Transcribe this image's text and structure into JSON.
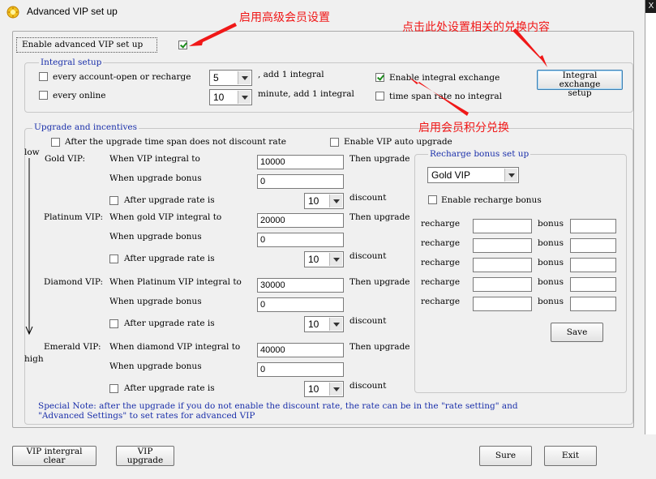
{
  "window": {
    "title": "Advanced VIP set up",
    "close_label": "X"
  },
  "annotations": {
    "enable_advanced": "启用高级会员设置",
    "click_exchange": "点击此处设置相关的兑换内容",
    "enable_points": "启用会员积分兑换"
  },
  "enable_advanced": {
    "label": "Enable advanced VIP set up",
    "checked": true
  },
  "integral_setup": {
    "legend": "Integral setup",
    "every_account": {
      "label": "every account-open or recharge",
      "checked": false
    },
    "account_value": "5",
    "add_integral_label": ", add 1 integral",
    "every_online": {
      "label": "every online",
      "checked": false
    },
    "online_value": "10",
    "minute_label": "minute, add 1 integral",
    "enable_exchange": {
      "label": "Enable integral exchange",
      "checked": true
    },
    "time_span": {
      "label": "time span rate no integral",
      "checked": false
    },
    "exchange_button": "Integral exchange setup"
  },
  "upgrade": {
    "legend": "Upgrade and incentives",
    "no_discount": {
      "label": "After the upgrade time span does not discount rate",
      "checked": false
    },
    "auto_upgrade": {
      "label": "Enable VIP auto upgrade",
      "checked": false
    },
    "low_label": "low",
    "high_label": "high",
    "then_upgrade": "Then upgrade",
    "bonus_label": "When upgrade bonus",
    "after_rate_label": "After upgrade rate is",
    "discount_label": "discount",
    "levels": [
      {
        "name": "Gold VIP:",
        "condition": "When VIP integral to",
        "integral": "10000",
        "bonus": "0",
        "rate": "10"
      },
      {
        "name": "Platinum VIP:",
        "condition": "When gold VIP integral to",
        "integral": "20000",
        "bonus": "0",
        "rate": "10"
      },
      {
        "name": "Diamond VIP:",
        "condition": "When Platinum VIP integral to",
        "integral": "30000",
        "bonus": "0",
        "rate": "10"
      },
      {
        "name": "Emerald VIP:",
        "condition": "When diamond VIP integral to",
        "integral": "40000",
        "bonus": "0",
        "rate": "10"
      }
    ],
    "note_line1": "Special Note: after the upgrade if you do not enable the discount rate, the rate can be in the \"rate setting\" and",
    "note_line2": "\"Advanced Settings\" to set rates for advanced VIP"
  },
  "recharge_bonus": {
    "legend": "Recharge bonus set up",
    "level_select": "Gold VIP",
    "enable": {
      "label": "Enable recharge bonus",
      "checked": false
    },
    "recharge_label": "recharge",
    "bonus_label": "bonus",
    "rows": [
      {
        "recharge": "",
        "bonus": ""
      },
      {
        "recharge": "",
        "bonus": ""
      },
      {
        "recharge": "",
        "bonus": ""
      },
      {
        "recharge": "",
        "bonus": ""
      },
      {
        "recharge": "",
        "bonus": ""
      }
    ],
    "save_button": "Save"
  },
  "footer": {
    "vip_clear_line1": "VIP intergral",
    "vip_clear_line2": "clear",
    "vip_upgrade_line1": "VIP",
    "vip_upgrade_line2": "upgrade",
    "sure_button": "Sure",
    "exit_button": "Exit"
  },
  "colors": {
    "annotation_red": "#f01818",
    "legend_blue": "#1a2faa",
    "check_green": "#1a8a1a"
  }
}
